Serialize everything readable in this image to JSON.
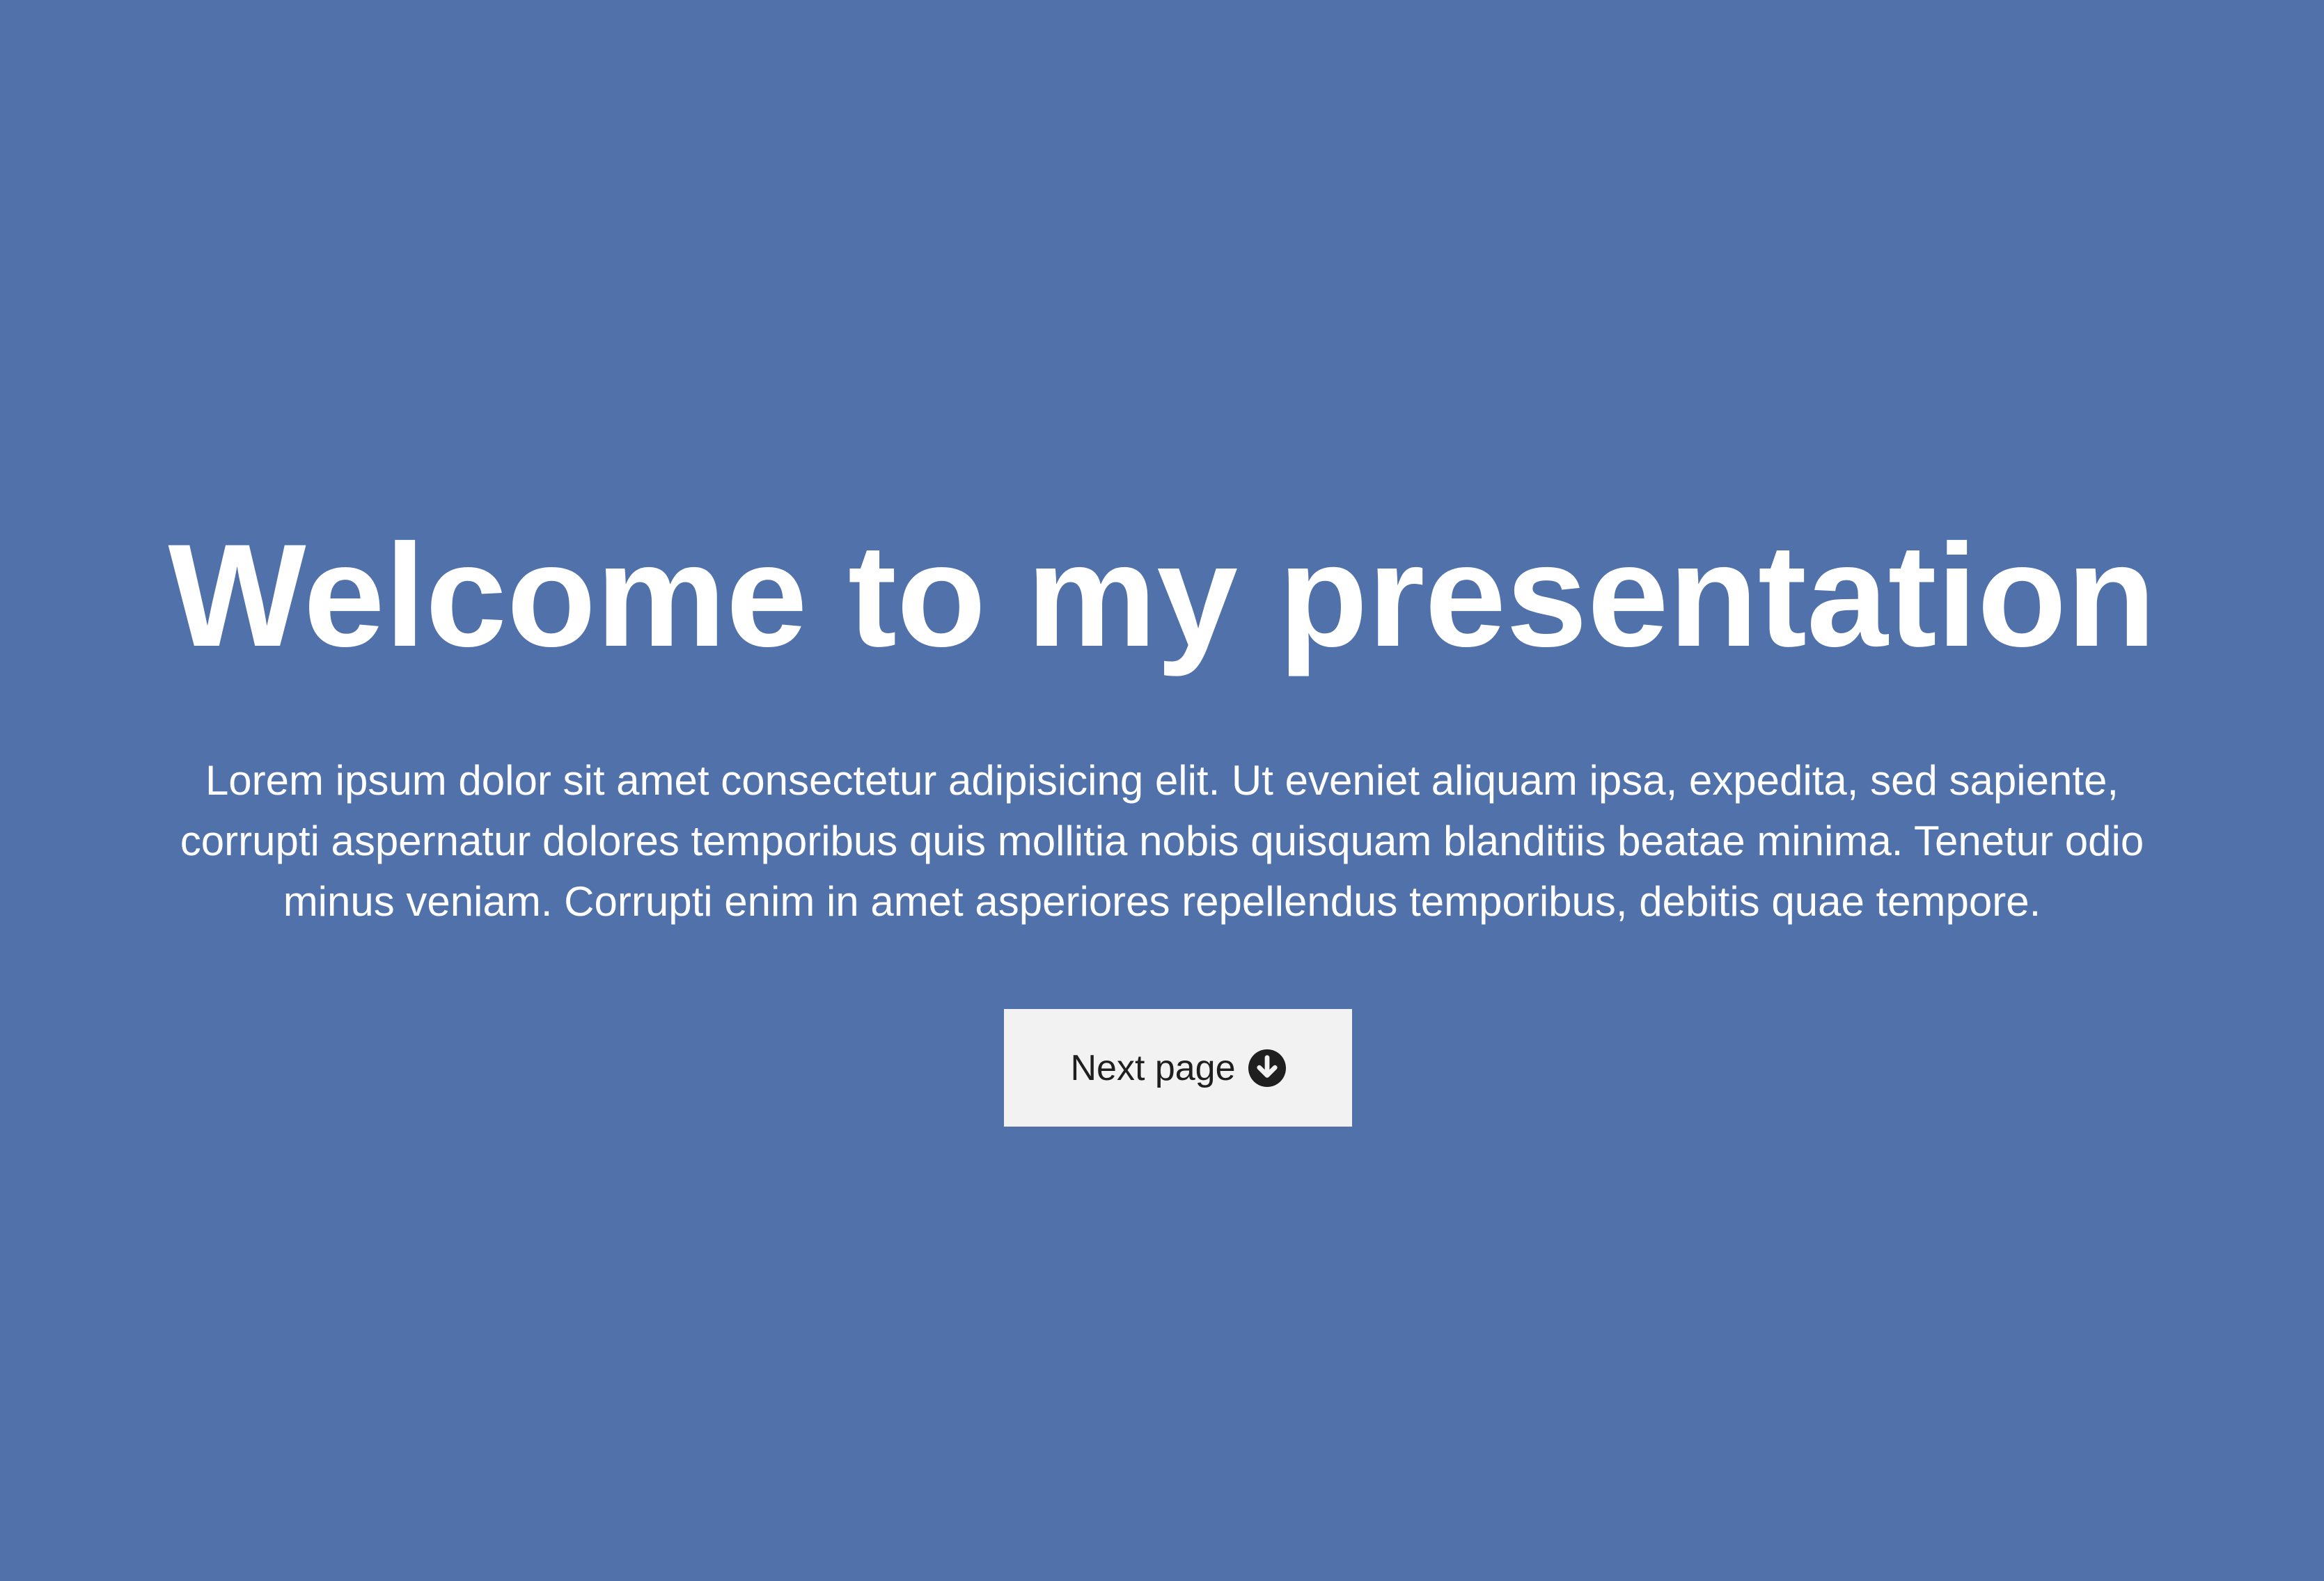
{
  "page": {
    "title": "Welcome to my presentation",
    "intro": "Lorem ipsum dolor sit amet consectetur adipisicing elit. Ut eveniet aliquam ipsa, expedita, sed sapiente, corrupti aspernatur dolores temporibus quis mollitia nobis quisquam blanditiis beatae minima. Tenetur odio minus veniam. Corrupti enim in amet asperiores repellendus temporibus, debitis quae tempore.",
    "next_button": {
      "label": "Next page",
      "icon": "arrow-circle-down-icon"
    }
  },
  "colors": {
    "background": "#5071aa",
    "text": "#ffffff",
    "button_background": "#f2f2f2",
    "button_text": "#1f1f1f"
  }
}
